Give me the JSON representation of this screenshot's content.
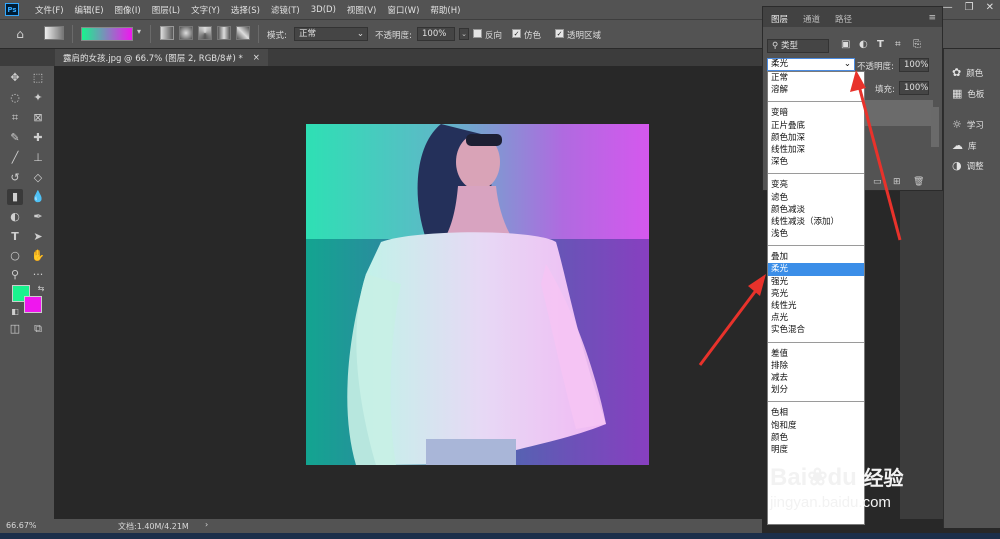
{
  "menubar": {
    "logo": "Ps",
    "items": [
      "文件(F)",
      "编辑(E)",
      "图像(I)",
      "图层(L)",
      "文字(Y)",
      "选择(S)",
      "滤镜(T)",
      "3D(D)",
      "视图(V)",
      "窗口(W)",
      "帮助(H)"
    ]
  },
  "options": {
    "mode_label": "模式:",
    "mode_value": "正常",
    "opacity_label": "不透明度:",
    "opacity_value": "100%",
    "reverse_label": "反向",
    "dither_label": "仿色",
    "transparency_label": "透明区域"
  },
  "document": {
    "tab_title": "露肩的女孩.jpg @ 66.7% (图层 2, RGB/8#) *",
    "close": "×"
  },
  "status": {
    "zoom": "66.67%",
    "doc_info": "文档:1.40M/4.21M"
  },
  "layers_panel": {
    "tabs": [
      "图层",
      "通道",
      "路径"
    ],
    "filter_label": "类型",
    "blend_value": "柔光",
    "opacity_label": "不透明度:",
    "opacity_value": "100%",
    "fill_label": "填充:",
    "fill_value": "100%"
  },
  "dock": {
    "items": [
      "颜色",
      "色板",
      "学习",
      "库",
      "调整"
    ]
  },
  "blend_modes": {
    "groups": [
      [
        "正常",
        "溶解"
      ],
      [
        "变暗",
        "正片叠底",
        "颜色加深",
        "线性加深",
        "深色"
      ],
      [
        "变亮",
        "滤色",
        "颜色减淡",
        "线性减淡（添加）",
        "浅色"
      ],
      [
        "叠加",
        "柔光",
        "强光",
        "亮光",
        "线性光",
        "点光",
        "实色混合"
      ],
      [
        "差值",
        "排除",
        "减去",
        "划分"
      ],
      [
        "色相",
        "饱和度",
        "颜色",
        "明度"
      ]
    ],
    "selected": "柔光"
  },
  "watermark": {
    "brand": "Bai",
    "brand2": "du",
    "suffix": "经验",
    "url": "jingyan.baidu.com"
  },
  "colors": {
    "foreground": "#19f28e",
    "background": "#ef17ee",
    "accent": "#3b8ee8",
    "arrow": "#e8322b"
  }
}
